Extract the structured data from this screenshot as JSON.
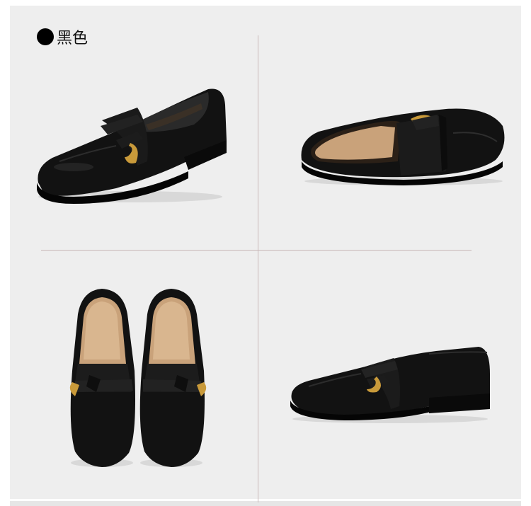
{
  "color_label": "黑色",
  "icons": {
    "bullet": "bullet-dot-icon"
  },
  "colors": {
    "background": "#eeeeee",
    "shoe": "#111111",
    "buckle": "#c99a3a",
    "insole": "#d9b68f"
  }
}
